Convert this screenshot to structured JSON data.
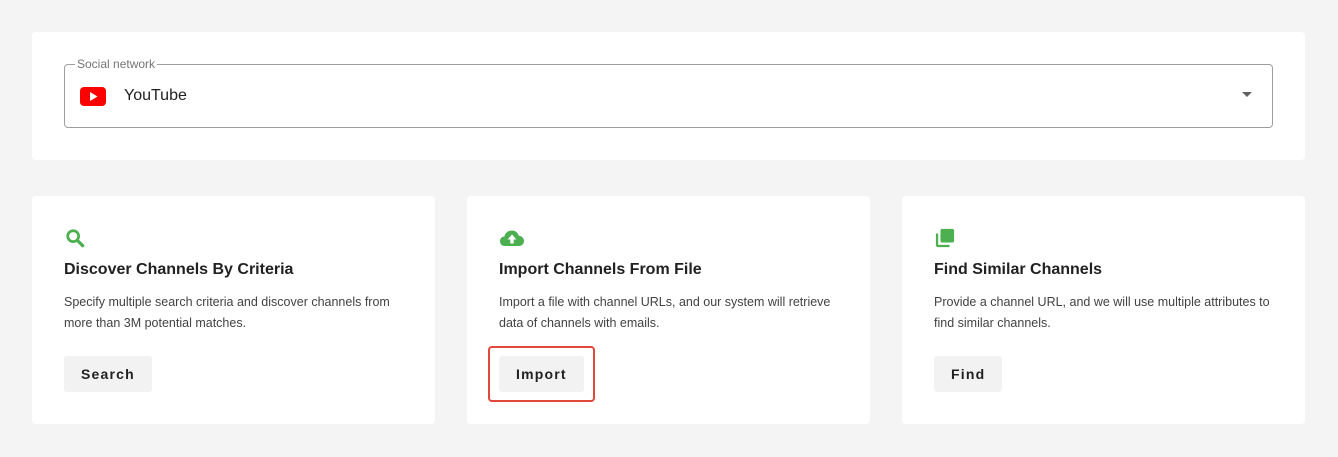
{
  "social_network": {
    "label": "Social network",
    "selected": "YouTube",
    "icon": "youtube-icon",
    "icon_color": "#ff0000"
  },
  "cards": [
    {
      "icon": "search-icon",
      "title": "Discover Channels By Criteria",
      "description": "Specify multiple search criteria and discover channels from more than 3M potential matches.",
      "button": "Search"
    },
    {
      "icon": "cloud-upload-icon",
      "title": "Import Channels From File",
      "description": "Import a file with channel URLs, and our system will retrieve data of channels with emails.",
      "button": "Import"
    },
    {
      "icon": "copy-icon",
      "title": "Find Similar Channels",
      "description": "Provide a channel URL, and we will use multiple attributes to find similar channels.",
      "button": "Find"
    }
  ],
  "colors": {
    "accent": "#4caf50",
    "highlight": "#e0483b",
    "background": "#f4f4f4"
  }
}
